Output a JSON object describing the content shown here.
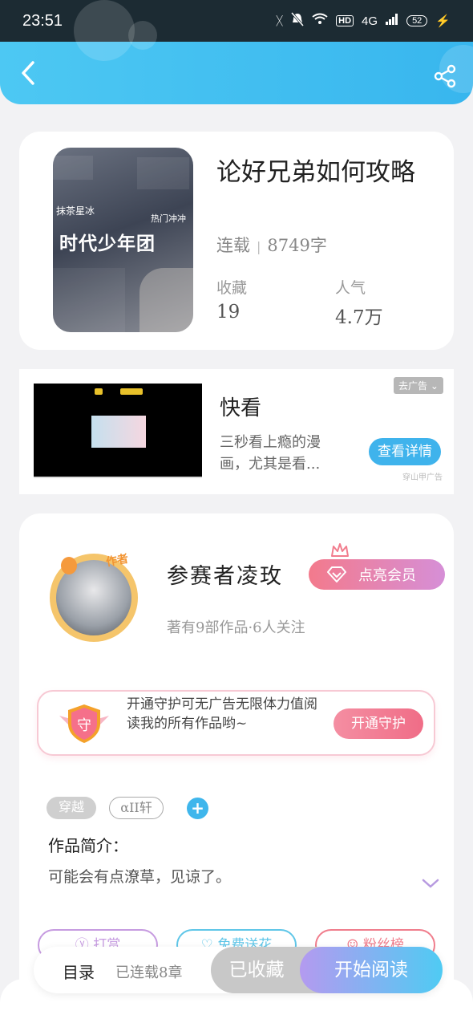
{
  "status_bar": {
    "time": "23:51",
    "network": "4G",
    "hd": "HD",
    "battery": "52"
  },
  "book": {
    "title": "论好兄弟如何攻略",
    "status": "连载",
    "word_count": "8749字",
    "favorites_label": "收藏",
    "favorites_value": "19",
    "popularity_label": "人气",
    "popularity_value": "4.7万",
    "cover": {
      "title": "时代少年团",
      "tag_right": "热门冲冲",
      "tag_left": "抹茶星冰"
    }
  },
  "ad": {
    "title": "快看",
    "description": "三秒看上瘾的漫画，尤其是看...",
    "remove_label": "去广告",
    "detail_button": "查看详情",
    "source": "穿山甲广告"
  },
  "author": {
    "name": "参赛者凌玫",
    "info": "著有9部作品·6人关注",
    "badge": "作者",
    "vip_button": "点亮会员"
  },
  "guard": {
    "icon_text": "守",
    "text": "开通守护可无广告无限体力值阅读我的所有作品哟~",
    "button": "开通守护"
  },
  "tags": [
    "穿越",
    "αII轩"
  ],
  "intro": {
    "title": "作品简介：",
    "text": "可能会有点潦草，见谅了。"
  },
  "actions": [
    {
      "label": "打赏",
      "color": "#c69be0"
    },
    {
      "label": "免费送花",
      "color": "#5fc6e8"
    },
    {
      "label": "粉丝榜",
      "color": "#f07d8c"
    }
  ],
  "bottom": {
    "catalog": "目录",
    "serial": "已连载8章",
    "collected": "已收藏",
    "read": "开始阅读"
  },
  "colors": {
    "accent": "#3fb6ec",
    "header": "#45c0f1",
    "vip": "#f37a8c"
  }
}
